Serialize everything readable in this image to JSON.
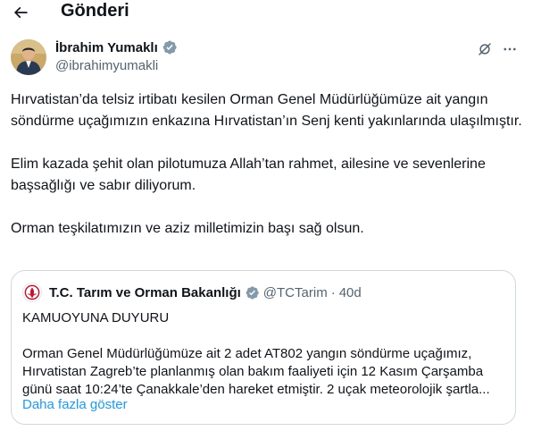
{
  "header": {
    "title": "Gönderi",
    "back_icon": "arrow-left-icon"
  },
  "author": {
    "name": "İbrahim Yumaklı",
    "handle": "@ibrahimyumakli",
    "verified": true,
    "verified_badge_color": "#829aab"
  },
  "actions": {
    "grok_icon": "grok-icon",
    "more_icon": "more-horizontal-icon"
  },
  "tweet": {
    "paragraphs": [
      "Hırvatistan’da telsiz irtibatı kesilen Orman Genel Müdürlüğümüze ait yangın söndürme uçağımızın enkazına Hırvatistan’ın Senj kenti yakınlarında ulaşılmıştır.",
      "Elim kazada şehit olan pilotumuza Allah’tan rahmet, ailesine ve sevenlerine başsağlığı ve sabır diliyorum.",
      "Orman teşkilatımızın ve aziz milletimizin başı sağ olsun."
    ]
  },
  "quote": {
    "name": "T.C. Tarım ve Orman Bakanlığı",
    "handle": "@TCTarim",
    "separator": "·",
    "time": "40d",
    "verified_badge_color": "#829aab",
    "logo_color": "#c8102e",
    "title": "KAMUOYUNA DUYURU",
    "lines": [
      "Orman Genel Müdürlüğümüze ait 2 adet AT802 yangın söndürme uçağımız,",
      "Hırvatistan Zagreb’te planlanmış olan bakım faaliyeti için 12 Kasım Çarşamba",
      "günü saat 10:24’te Çanakkale’den hareket etmiştir. 2 uçak meteorolojik şartla..."
    ],
    "show_more": "Daha fazla göster"
  },
  "colors": {
    "text": "#0f1419",
    "secondary": "#536471",
    "link": "#1d9bf0",
    "border": "#cfd9de"
  }
}
